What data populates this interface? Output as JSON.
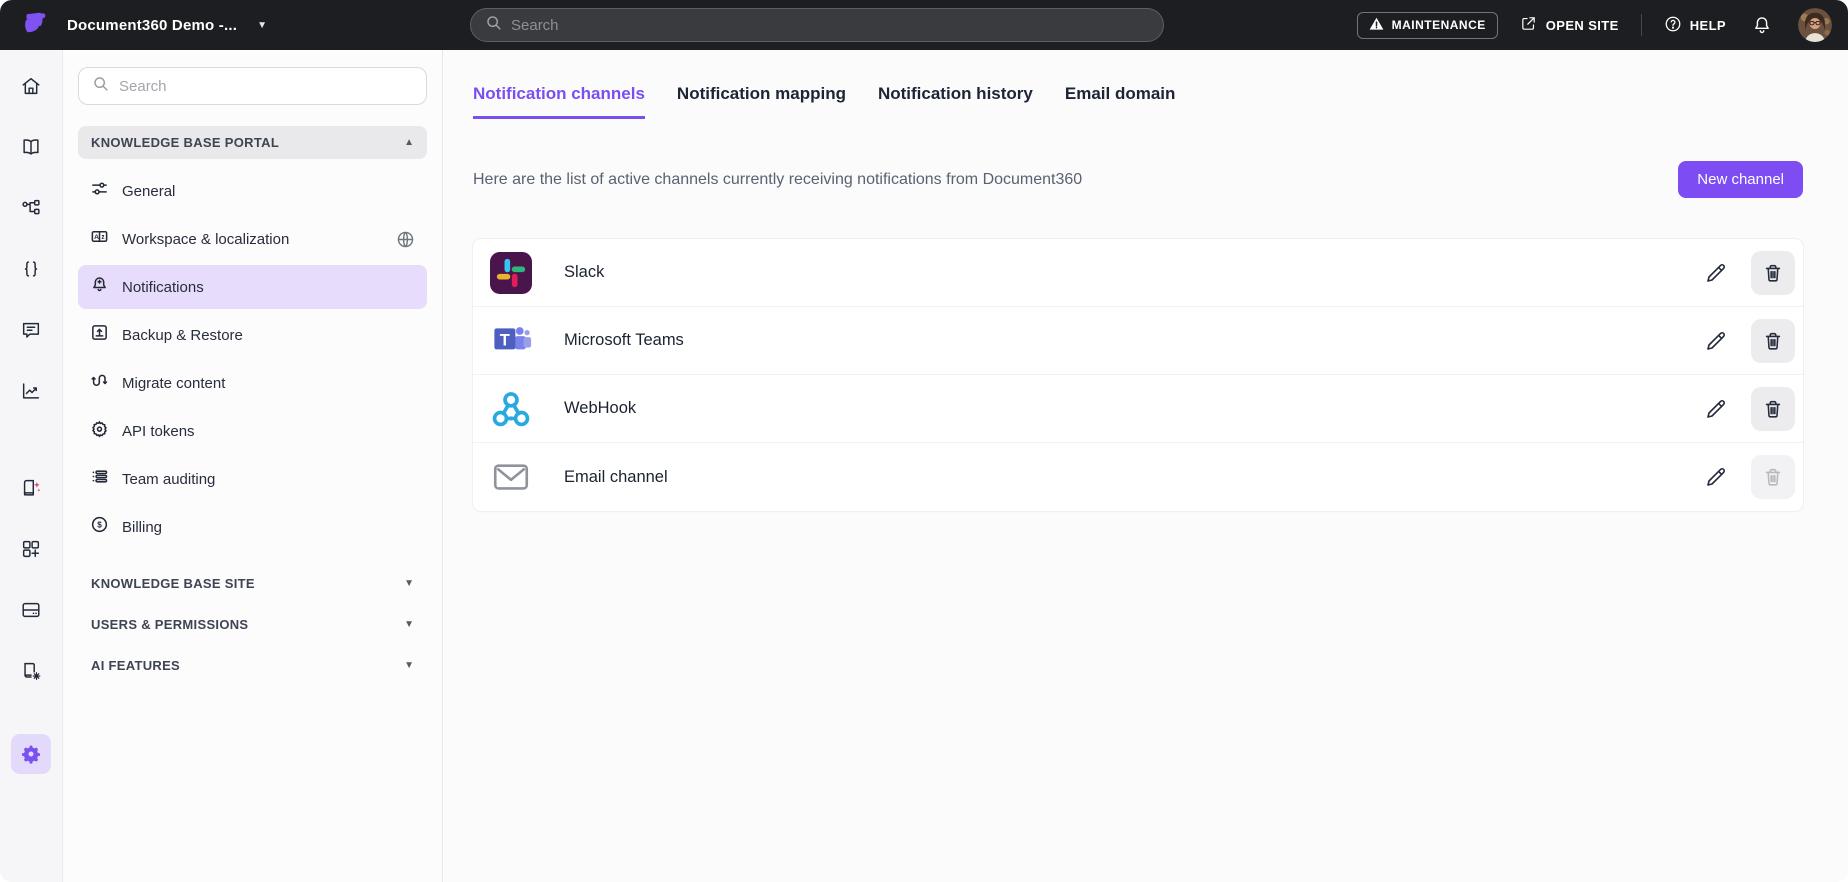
{
  "topbar": {
    "brand": "Document360 Demo -...",
    "search_placeholder": "Search",
    "maintenance_label": "MAINTENANCE",
    "open_site_label": "OPEN SITE",
    "help_label": "HELP"
  },
  "sidebar": {
    "search_placeholder": "Search",
    "sections": [
      {
        "label": "KNOWLEDGE BASE PORTAL",
        "expanded": true,
        "caret": "▲",
        "items": [
          {
            "label": "General",
            "icon": "sliders-icon",
            "active": false
          },
          {
            "label": "Workspace & localization",
            "icon": "translate-icon",
            "active": false,
            "trailing_icon": "globe-icon"
          },
          {
            "label": "Notifications",
            "icon": "bell-plus-icon",
            "active": true
          },
          {
            "label": "Backup & Restore",
            "icon": "backup-icon",
            "active": false
          },
          {
            "label": "Migrate content",
            "icon": "migrate-icon",
            "active": false
          },
          {
            "label": "API tokens",
            "icon": "api-gear-icon",
            "active": false
          },
          {
            "label": "Team auditing",
            "icon": "audit-list-icon",
            "active": false
          },
          {
            "label": "Billing",
            "icon": "dollar-circle-icon",
            "active": false
          }
        ]
      },
      {
        "label": "KNOWLEDGE BASE SITE",
        "expanded": false,
        "caret": "▼"
      },
      {
        "label": "USERS & PERMISSIONS",
        "expanded": false,
        "caret": "▼"
      },
      {
        "label": "AI FEATURES",
        "expanded": false,
        "caret": "▼"
      }
    ]
  },
  "rail": {
    "icons": [
      "home-icon",
      "docs-book-icon",
      "categories-icon",
      "api-braces-icon",
      "feedback-comment-icon",
      "analytics-icon",
      "ai-book-icon",
      "widgets-icon",
      "drive-icon",
      "kb-site-book-gear-icon",
      "settings-gear-icon"
    ],
    "active_icon": "settings-gear-icon"
  },
  "main": {
    "tabs": [
      {
        "label": "Notification channels",
        "active": true
      },
      {
        "label": "Notification mapping",
        "active": false
      },
      {
        "label": "Notification history",
        "active": false
      },
      {
        "label": "Email domain",
        "active": false
      }
    ],
    "description": "Here are the list of active channels currently receiving notifications from Document360",
    "new_channel_label": "New channel",
    "channels": [
      {
        "name": "Slack",
        "icon": "slack-logo",
        "delete_enabled": true
      },
      {
        "name": "Microsoft Teams",
        "icon": "ms-teams-logo",
        "delete_enabled": true
      },
      {
        "name": "WebHook",
        "icon": "webhook-logo",
        "delete_enabled": true
      },
      {
        "name": "Email channel",
        "icon": "email-envelope",
        "delete_enabled": false
      }
    ]
  },
  "colors": {
    "accent_purple": "#7d4cf2",
    "active_item_bg": "#e7dcfb",
    "topbar_bg": "#1d1e21",
    "slack_plum": "#4a154b",
    "slack_blue": "#36c5f0",
    "slack_green": "#2eb67d",
    "slack_red": "#e01e5a",
    "slack_yellow": "#ecb22e",
    "teams_purple": "#4e5fbf",
    "webhook_blue": "#29a9e0",
    "ai_sparkle_pink": "#e0447c"
  },
  "glyphs": {
    "caret_up": "▲",
    "caret_down": "▼",
    "brand_caret": "▼"
  }
}
